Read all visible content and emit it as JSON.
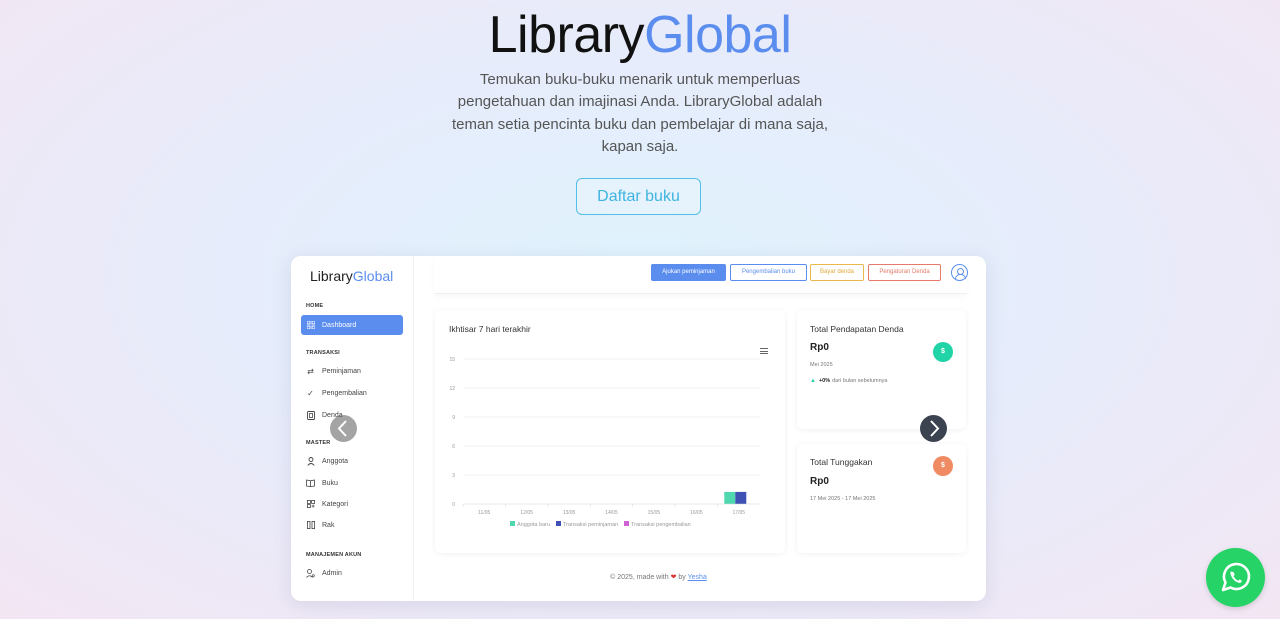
{
  "hero": {
    "title_part1": "Library",
    "title_part2": "Global",
    "description": "Temukan buku-buku menarik untuk memperluas pengetahuan dan imajinasi Anda. LibraryGlobal adalah teman setia pencinta buku dan pembelajar di mana saja, kapan saja.",
    "cta_label": "Daftar buku"
  },
  "preview": {
    "logo_part1": "Library",
    "logo_part2": "Global",
    "sidebar": {
      "sections": [
        {
          "label": "HOME",
          "items": [
            {
              "label": "Dashboard",
              "icon": "grid-icon",
              "active": true
            }
          ]
        },
        {
          "label": "TRANSAKSI",
          "items": [
            {
              "label": "Peminjaman",
              "icon": "swap-icon"
            },
            {
              "label": "Pengembalian",
              "icon": "check-icon"
            },
            {
              "label": "Denda",
              "icon": "wallet-icon"
            }
          ]
        },
        {
          "label": "MASTER",
          "items": [
            {
              "label": "Anggota",
              "icon": "user-icon"
            },
            {
              "label": "Buku",
              "icon": "book-icon"
            },
            {
              "label": "Kategori",
              "icon": "category-icon"
            },
            {
              "label": "Rak",
              "icon": "shelf-icon"
            }
          ]
        },
        {
          "label": "MANAJEMEN AKUN",
          "items": [
            {
              "label": "Admin",
              "icon": "user-gear-icon"
            }
          ]
        }
      ]
    },
    "topbar": {
      "buttons": [
        {
          "label": "Ajukan peminjaman",
          "color": "#5b8def",
          "filled": true
        },
        {
          "label": "Pengembalian buku",
          "color": "#5b8def",
          "filled": false
        },
        {
          "label": "Bayar denda",
          "color": "#e8b84a",
          "filled": false
        },
        {
          "label": "Pengaturan Denda",
          "color": "#e57a6a",
          "filled": false
        }
      ]
    },
    "chart_panel": {
      "title": "Ikhtisar 7 hari terakhir"
    },
    "stats": [
      {
        "title": "Total Pendapatan Denda",
        "value": "Rp0",
        "date": "Mei 2025",
        "trend": "+0%",
        "trend_label": "dari bulan sebelumnya",
        "badge": "$",
        "color": "#21d4a7"
      },
      {
        "title": "Total Tunggakan",
        "value": "Rp0",
        "date": "17 Mei 2025 - 17 Mei 2025",
        "badge": "$",
        "color": "#f08a62"
      }
    ],
    "footer": {
      "text": "© 2025, made with",
      "by": "by",
      "author": "Yesha"
    }
  },
  "chart_data": {
    "type": "bar",
    "categories": [
      "11/05",
      "12/05",
      "13/05",
      "14/05",
      "15/05",
      "16/05",
      "17/05"
    ],
    "y_ticks": [
      "0",
      "3",
      "6",
      "9",
      "12",
      "15"
    ],
    "ylim": [
      0,
      15
    ],
    "series": [
      {
        "name": "Anggota baru",
        "color": "#4fd8b0",
        "values": [
          0,
          0,
          0,
          0,
          0,
          0,
          1
        ]
      },
      {
        "name": "Transaksi peminjaman",
        "color": "#3f51b5",
        "values": [
          0,
          0,
          0,
          0,
          0,
          0,
          1
        ]
      },
      {
        "name": "Transaksi pengembalian",
        "color": "#d063d6",
        "values": [
          0,
          0,
          0,
          0,
          0,
          0,
          0
        ]
      }
    ],
    "legend": "bottom",
    "grid": true
  },
  "carousel": {
    "prev_icon": "chevron-left-icon",
    "next_icon": "chevron-right-icon"
  },
  "whatsapp": {
    "icon": "whatsapp-icon",
    "color": "#25d366"
  }
}
